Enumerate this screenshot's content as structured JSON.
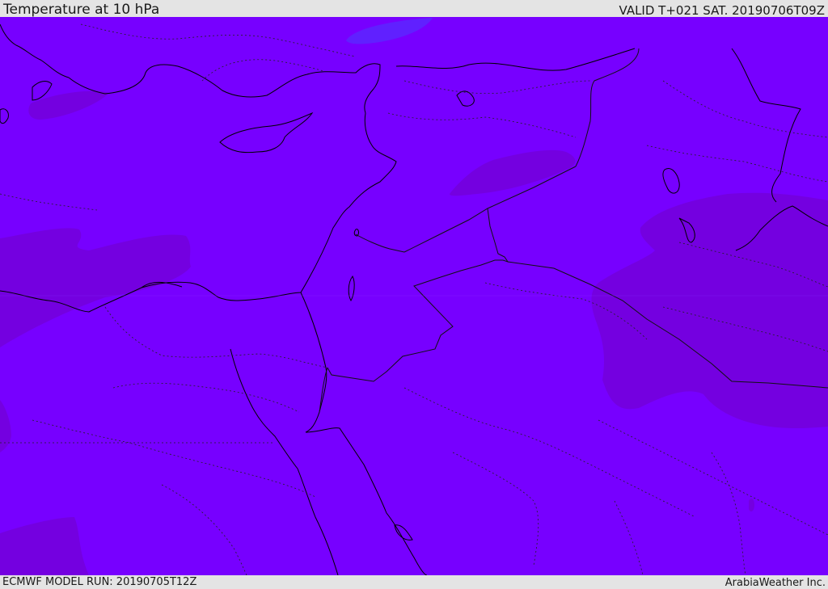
{
  "header": {
    "title": "Temperature at 10 hPa",
    "valid": "VALID T+021 SAT. 20190706T09Z"
  },
  "footer": {
    "model_run": "ECMWF MODEL RUN: 20190705T12Z",
    "credit": "ArabiaWeather Inc."
  },
  "map": {
    "colors": {
      "base_field": "#7700ff",
      "cool_patch": "#6020ff",
      "warm_patch": "#7400e0",
      "coastline": "#000000",
      "border": "#222222"
    }
  }
}
